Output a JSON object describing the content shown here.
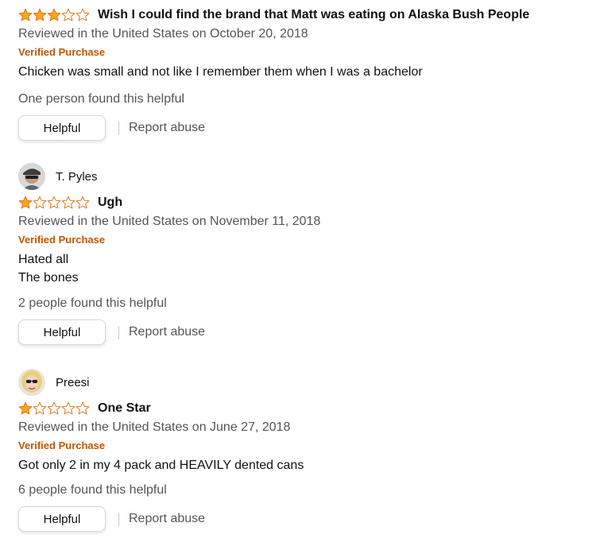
{
  "reviews": [
    {
      "rating": 3,
      "title": "Wish I could find the brand that Matt was eating on Alaska Bush People",
      "date": "Reviewed in the United States on October 20, 2018",
      "verified": "Verified Purchase",
      "body": [
        "Chicken was small and not like I remember them when I was a bachelor"
      ],
      "helpful_count": "One person found this helpful",
      "helpful_button": "Helpful",
      "report": "Report abuse"
    },
    {
      "reviewer": "T. Pyles",
      "avatar_icon": "person-with-cap-avatar-icon",
      "rating": 1,
      "title": "Ugh",
      "date": "Reviewed in the United States on November 11, 2018",
      "verified": "Verified Purchase",
      "body": [
        "Hated all",
        "The bones"
      ],
      "helpful_count": "2 people found this helpful",
      "helpful_button": "Helpful",
      "report": "Report abuse"
    },
    {
      "reviewer": "Preesi",
      "avatar_icon": "blonde-person-avatar-icon",
      "rating": 1,
      "title": "One Star",
      "date": "Reviewed in the United States on June 27, 2018",
      "verified": "Verified Purchase",
      "body": [
        "Got only 2 in my 4 pack and HEAVILY dented cans"
      ],
      "helpful_count": "6 people found this helpful",
      "helpful_button": "Helpful",
      "report": "Report abuse"
    }
  ],
  "colors": {
    "star_fill": "#ffa41c",
    "star_outline": "#de7921",
    "verified": "#c45500"
  }
}
